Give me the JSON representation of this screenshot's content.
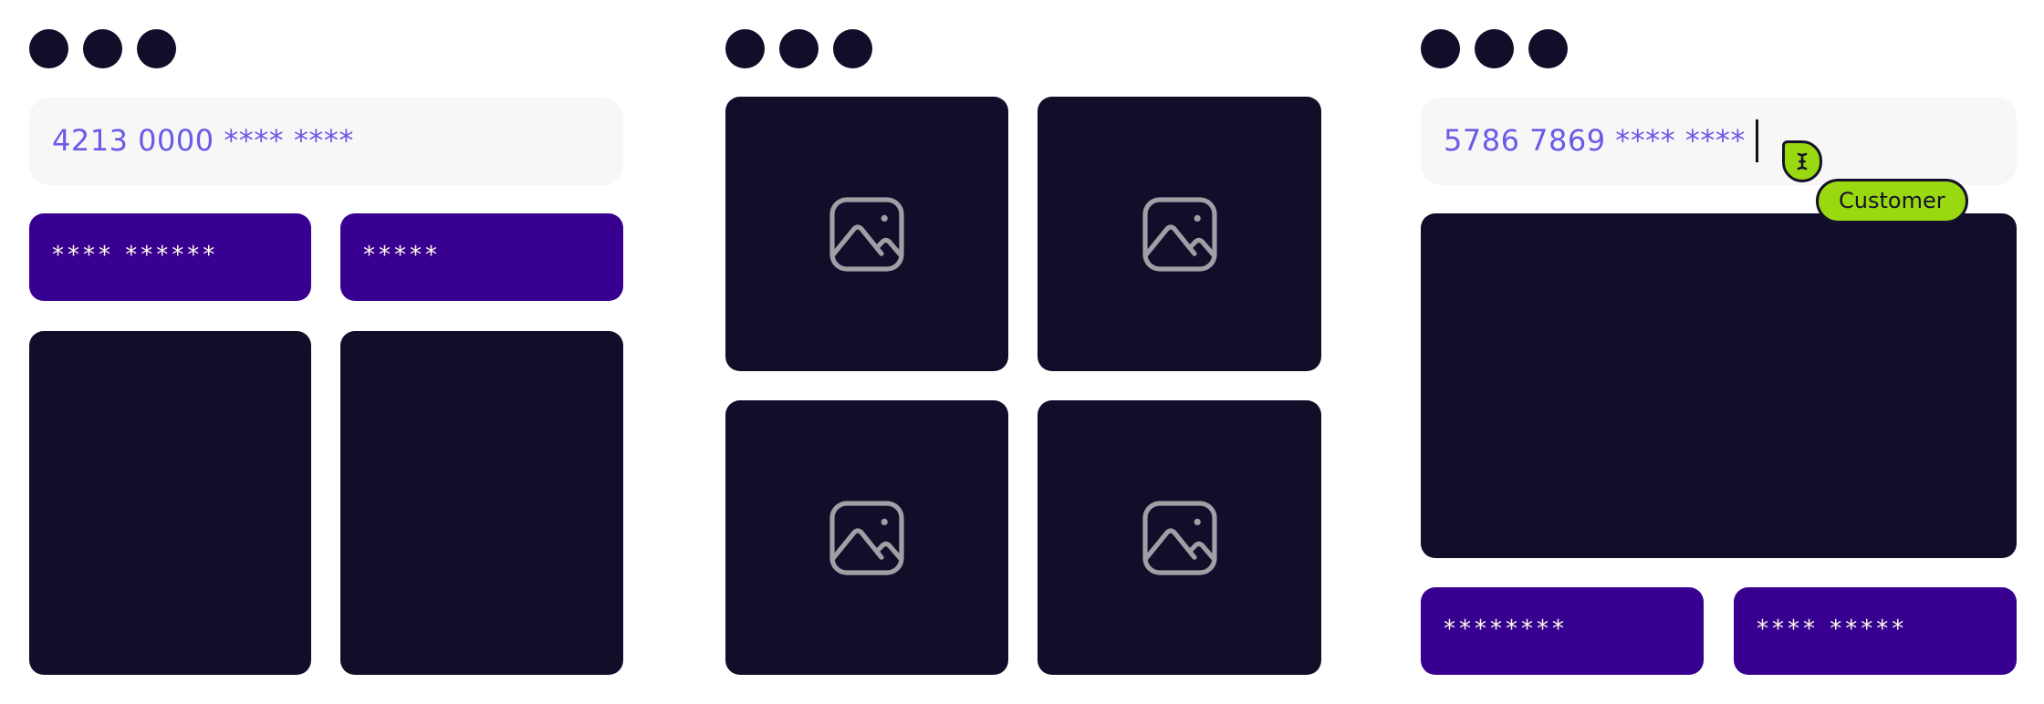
{
  "colors": {
    "dark": "#100e29",
    "button": "#380090",
    "input_text": "#6a5ae8",
    "input_bg": "#f7f7f7",
    "badge": "#9ad910",
    "icon_stroke": "#a09fa6"
  },
  "panels": [
    {
      "input_value": "4213 0000 **** ****",
      "buttons": [
        {
          "label": "**** ******"
        },
        {
          "label": "*****"
        }
      ]
    },
    {
      "tiles": [
        {
          "icon": "image-icon"
        },
        {
          "icon": "image-icon"
        },
        {
          "icon": "image-icon"
        },
        {
          "icon": "image-icon"
        }
      ]
    },
    {
      "input_value": "5786 7869 **** ****",
      "cursor_badge": "Customer",
      "buttons": [
        {
          "label": "********"
        },
        {
          "label": "**** *****"
        }
      ]
    }
  ]
}
